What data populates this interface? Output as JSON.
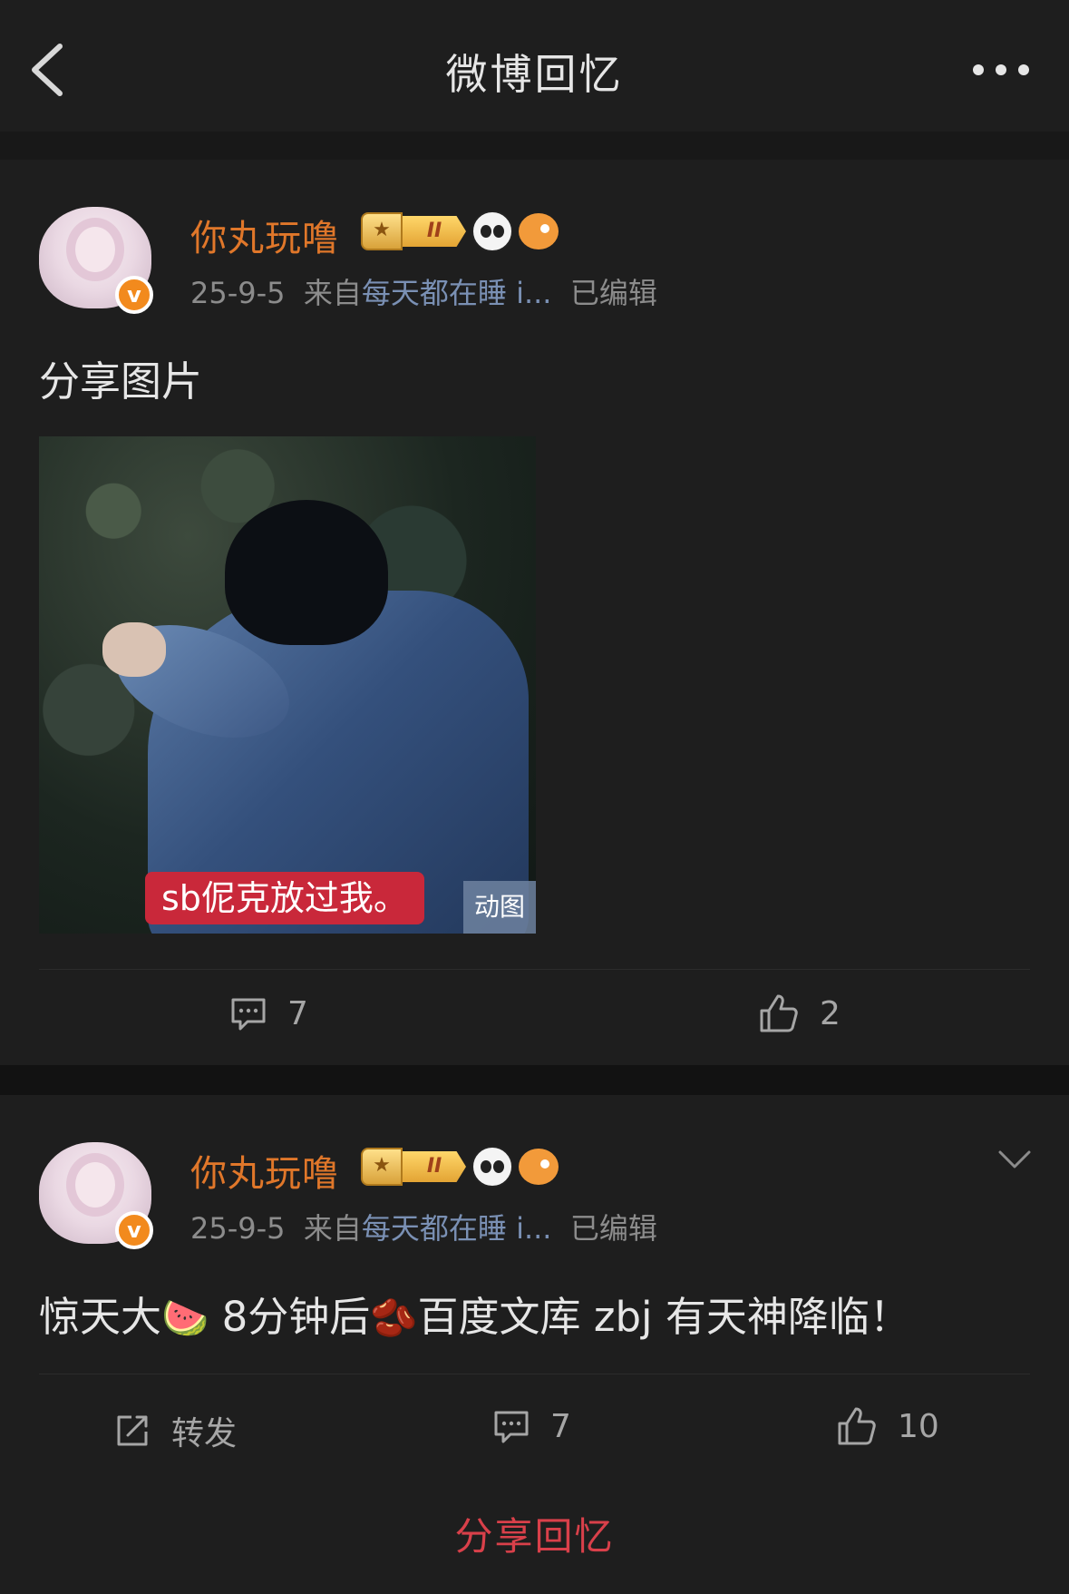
{
  "header": {
    "title": "微博回忆",
    "back_icon": "chevron-left-icon",
    "more_icon": "more-dots-icon"
  },
  "posts": [
    {
      "user": {
        "name": "你丸玩噜",
        "verified_badge": "v",
        "level_badge": "II"
      },
      "meta": {
        "date": "25-9-5",
        "source_prefix": "来自",
        "source": "每天都在睡 i...",
        "edited": "已编辑"
      },
      "text": "分享图片",
      "media": {
        "caption": "sb伲克放过我。",
        "gif_tag": "动图"
      },
      "actions": {
        "comments": "7",
        "likes": "2"
      }
    },
    {
      "user": {
        "name": "你丸玩噜",
        "verified_badge": "v",
        "level_badge": "II"
      },
      "meta": {
        "date": "25-9-5",
        "source_prefix": "来自",
        "source": "每天都在睡 i...",
        "edited": "已编辑"
      },
      "text_parts": [
        "惊天大",
        "🍉",
        " 8分钟后",
        "🫘",
        "百度文库 zbj 有天神降临！"
      ],
      "actions": {
        "repost": "转发",
        "comments": "7",
        "likes": "10"
      }
    }
  ],
  "footer": {
    "share_label": "分享回忆"
  },
  "colors": {
    "accent_orange": "#e0772a",
    "source_link": "#7a90b4",
    "share_red": "#d9404a"
  }
}
